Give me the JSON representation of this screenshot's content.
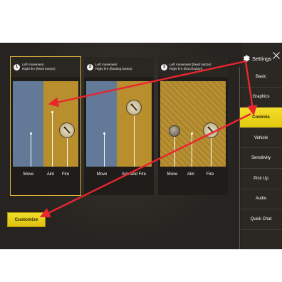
{
  "settings": {
    "title": "Settings"
  },
  "menu": {
    "items": [
      {
        "label": "Basic"
      },
      {
        "label": "Graphics"
      },
      {
        "label": "Controls"
      },
      {
        "label": "Vehicle"
      },
      {
        "label": "Sensitivity"
      },
      {
        "label": "Pick Up"
      },
      {
        "label": "Audio"
      },
      {
        "label": "Quick Chat"
      },
      {
        "label": ""
      }
    ],
    "active": "Controls"
  },
  "schemes": [
    {
      "number": "1",
      "line1": "Left movement",
      "line2": "Right fire (fixed button)",
      "labels": {
        "move": "Move",
        "aim": "Aim",
        "fire": "Fire"
      }
    },
    {
      "number": "2",
      "line1": "Left movement",
      "line2": "Right fire (floating button)",
      "labels": {
        "move": "Move",
        "aim_fire": "Aim and Fire"
      }
    },
    {
      "number": "3",
      "line1": "Left movement (fixed button)",
      "line2": "Right fire (fixed button)",
      "labels": {
        "move": "Move",
        "aim": "Aim",
        "fire": "Fire"
      }
    }
  ],
  "customize": {
    "label": "Customize"
  },
  "icons": {
    "settings": "gear-icon",
    "close": "close-icon",
    "fire": "bullet-icon"
  },
  "colors": {
    "accent": "#f0d820",
    "selection": "#e0b83a",
    "annotation": "#e8262e"
  }
}
